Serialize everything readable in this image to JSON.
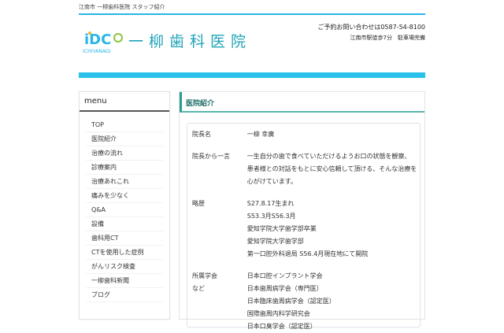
{
  "breadcrumb": "江南市 一柳歯科医院 スタッフ紹介",
  "header": {
    "logo_text": "ICHIYANAGI",
    "title": "一柳歯科医院",
    "contact": "ご予約お問い合わせは0587-54-8100",
    "access": "江南市駅徒歩7分　駐車場完備"
  },
  "sidebar": {
    "title": "menu",
    "items": [
      "TOP",
      "医院紹介",
      "治療の流れ",
      "診療案内",
      "治療あれこれ",
      "痛みを少なく",
      "Q&A",
      "設備",
      "歯科用CT",
      "CTを使用した症例",
      "がんリスク検査",
      "一柳歯科新聞",
      "ブログ"
    ]
  },
  "main": {
    "title": "医院紹介",
    "rows": [
      {
        "label": "院長名",
        "lines": [
          "一柳 幸廣"
        ]
      },
      {
        "label": "院長から一言",
        "lines": [
          "一生自分の歯で食べていただけるようお口の状態を観察、",
          "患者様との対話をもとに安心信頼して頂ける、そんな治療を",
          "心がけています。"
        ]
      },
      {
        "label": "略歴",
        "lines": [
          "S27.8.17生まれ",
          "S53.3月S56.3月",
          "愛知学院大学歯学部卒業",
          "愛知学院大学歯学部",
          "第一口腔外科退局 S56.4月現在地にて開院"
        ]
      },
      {
        "label": "所属学会\nなど",
        "lines": [
          "日本口腔インプラント学会",
          "日本歯周病学会（専門医）",
          "日本臨床歯周病学会（認定医）",
          "国際歯周内科学研究会",
          "日本口臭学会（認定医）"
        ]
      }
    ]
  },
  "colors": {
    "accent": "#29c0ec",
    "teal": "#2a9d8f"
  }
}
